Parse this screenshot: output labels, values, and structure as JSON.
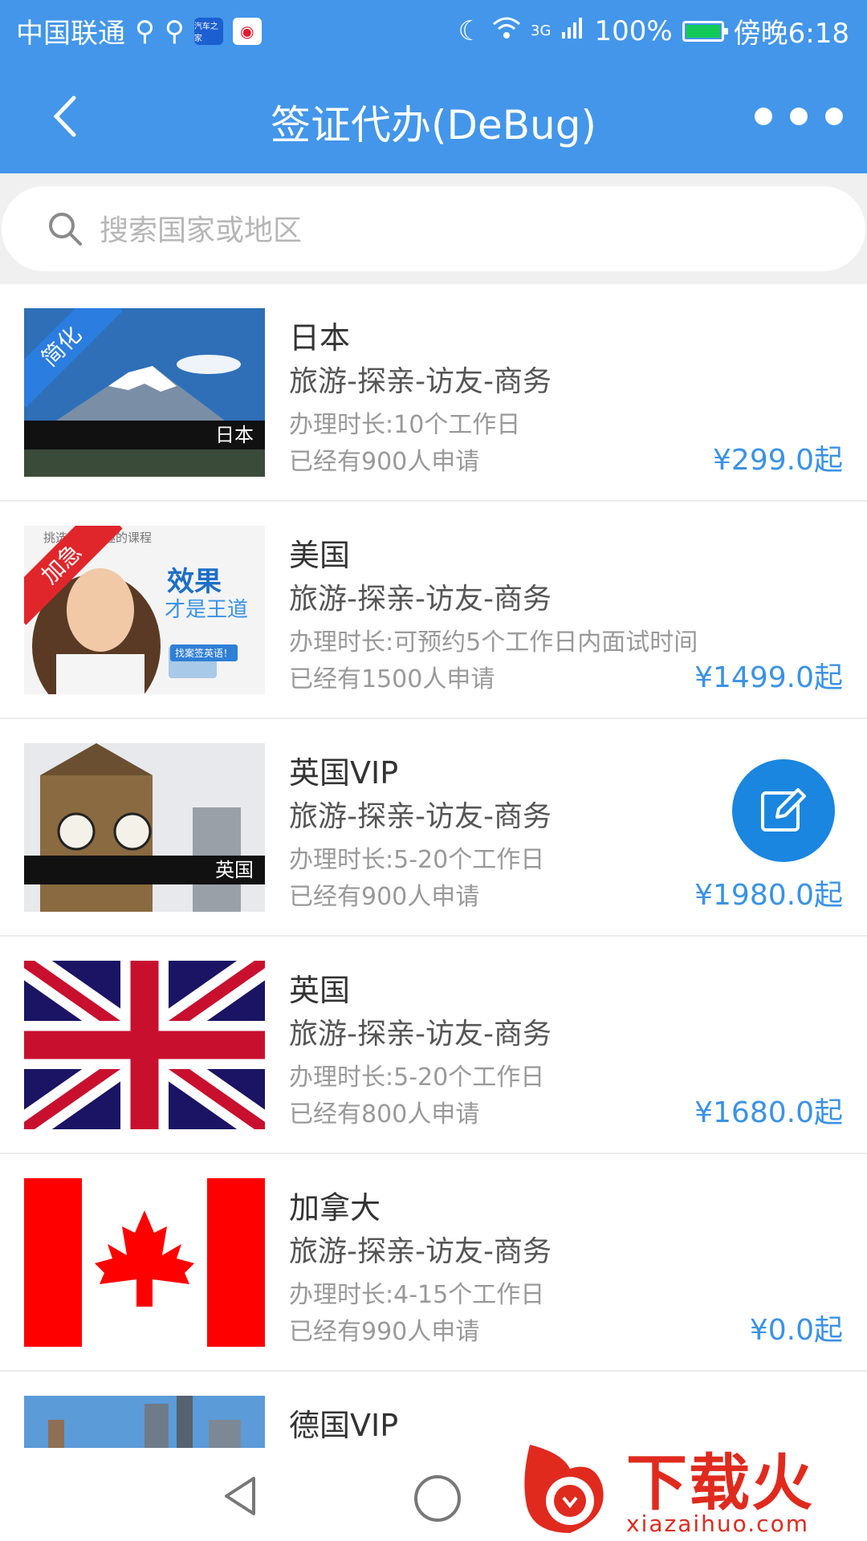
{
  "status_bar": {
    "carrier": "中国联通",
    "app_icon_1": "汽车之家",
    "battery": "100%",
    "network": "3G",
    "time": "傍晚6:18"
  },
  "title_bar": {
    "title": "签证代办(DeBug)"
  },
  "search": {
    "placeholder": "搜索国家或地区"
  },
  "items": [
    {
      "name": "日本",
      "types": "旅游-探亲-访友-商务",
      "duration": "办理时长:10个工作日",
      "applied": "已经有900人申请",
      "price": "¥299.0起",
      "ribbon": "简化",
      "thumb_caption": "日本"
    },
    {
      "name": "美国",
      "types": "旅游-探亲-访友-商务",
      "duration": "办理时长:可预约5个工作日内面试时间",
      "applied": "已经有1500人申请",
      "price": "¥1499.0起",
      "ribbon": "加急",
      "ad_line": "挑选你感兴趣的课程",
      "ad_title": "效果",
      "ad_subtitle": "才是王道",
      "ad_button": "找案签英语！"
    },
    {
      "name": "英国VIP",
      "types": "旅游-探亲-访友-商务",
      "duration": "办理时长:5-20个工作日",
      "applied": "已经有900人申请",
      "price": "¥1980.0起",
      "thumb_caption": "英国"
    },
    {
      "name": "英国",
      "types": "旅游-探亲-访友-商务",
      "duration": "办理时长:5-20个工作日",
      "applied": "已经有800人申请",
      "price": "¥1680.0起"
    },
    {
      "name": "加拿大",
      "types": "旅游-探亲-访友-商务",
      "duration": "办理时长:4-15个工作日",
      "applied": "已经有990人申请",
      "price": "¥0.0起"
    },
    {
      "name": "德国VIP"
    }
  ],
  "watermark": {
    "text": "下载火",
    "url": "xiazaihuo.com"
  },
  "colors": {
    "primary": "#4396e9",
    "price": "#3a92e6",
    "fab": "#1a86e0"
  }
}
